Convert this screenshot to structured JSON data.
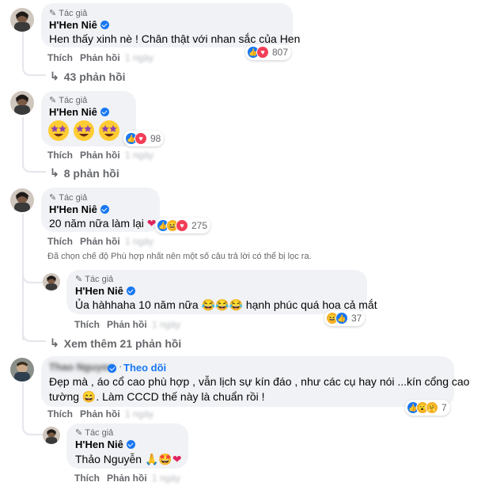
{
  "comments": [
    {
      "author_tag": "Tác giả",
      "author": "H'Hen Niê",
      "text": "Hen thấy xinh nè ! Chân thật với nhan sắc của Hen",
      "like_label": "Thích",
      "reply_label": "Phản hồi",
      "reaction_count": "807",
      "replies_label": "43 phản hồi"
    },
    {
      "author_tag": "Tác giả",
      "author": "H'Hen Niê",
      "text": "",
      "like_label": "Thích",
      "reply_label": "Phản hồi",
      "reaction_count": "98",
      "replies_label": "8 phản hồi"
    },
    {
      "author_tag": "Tác giả",
      "author": "H'Hen Niê",
      "text": "20 năm nữa làm lại",
      "like_label": "Thích",
      "reply_label": "Phản hồi",
      "reaction_count": "275",
      "filter_note": "Đã chọn chế độ Phù hợp nhất nên một số câu trả lời có thể bị lọc ra.",
      "reply": {
        "author_tag": "Tác giả",
        "author": "H'Hen Niê",
        "text_a": "Ủa hàhhaha 10 năm nữa",
        "text_b": "hạnh phúc quá hoa cả mắt",
        "like_label": "Thích",
        "reply_label": "Phản hồi",
        "reaction_count": "37"
      },
      "more_replies_label": "Xem thêm 21 phản hồi"
    },
    {
      "follow_label": "Theo dõi",
      "text_line1": "Đẹp mà , áo cổ cao phù hợp , vẫn lịch sự kín đáo , như các cụ hay nói ...kín cổng cao",
      "text_line2a": "tường",
      "text_line2b": ". Làm CCCD thế này là chuẩn rồi !",
      "like_label": "Thích",
      "reply_label": "Phản hồi",
      "reaction_count": "7",
      "reply": {
        "author_tag": "Tác giả",
        "author": "H'Hen Niê",
        "text": "Thảo Nguyễn",
        "like_label": "Thích",
        "reply_label": "Phản hồi"
      }
    }
  ],
  "colors": {
    "bubble": "#f0f2f5",
    "secondary_text": "#65676b",
    "accent": "#1877f2"
  }
}
